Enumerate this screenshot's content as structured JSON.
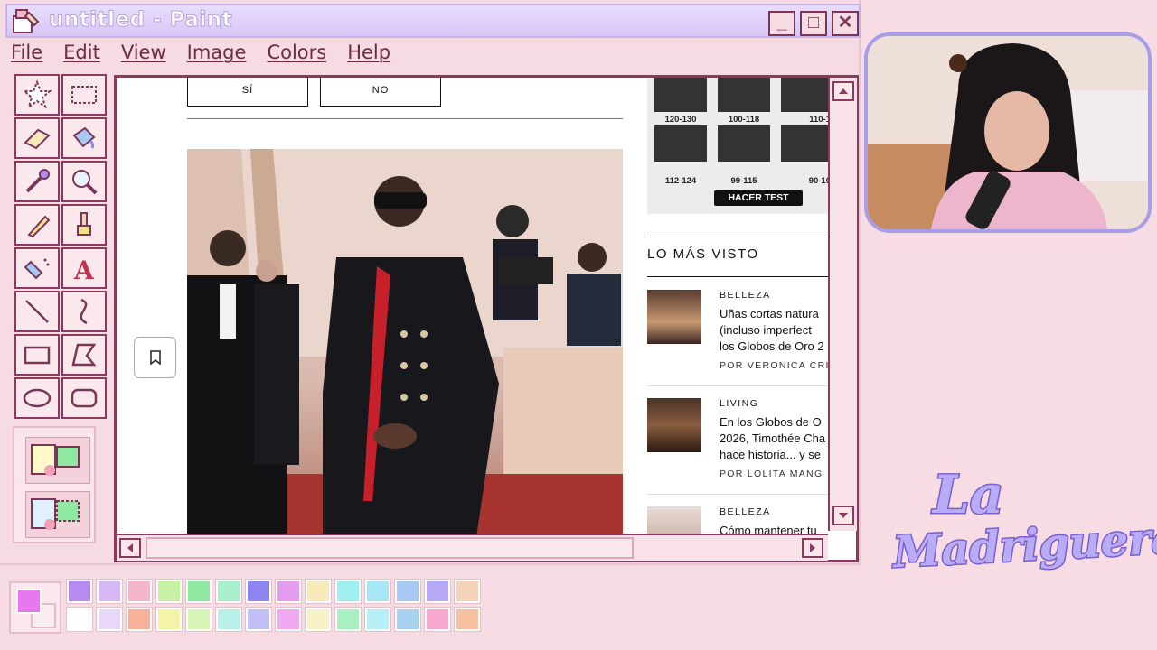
{
  "window": {
    "title": "untitled - Paint"
  },
  "menu": [
    "File",
    "Edit",
    "View",
    "Image",
    "Colors",
    "Help"
  ],
  "tools": [
    "free-select",
    "rect-select",
    "eraser",
    "fill",
    "color-picker",
    "magnifier",
    "pencil",
    "brush",
    "airbrush",
    "text",
    "line",
    "curve",
    "rectangle",
    "polygon",
    "ellipse",
    "rounded-rectangle"
  ],
  "web": {
    "buttons": {
      "yes": "SÍ",
      "no": "NO"
    },
    "iq": {
      "scores": [
        "120-130",
        "100-118",
        "110-1",
        "112-124",
        "99-115",
        "90-10"
      ],
      "button": "HACER TEST"
    },
    "lomas": {
      "heading": "LO MÁS VISTO"
    },
    "articles": [
      {
        "category": "BELLEZA",
        "title_lines": [
          "Uñas cortas natura",
          "(incluso imperfect",
          "los Globos de Oro 2"
        ],
        "author": "POR VERONICA CRIS"
      },
      {
        "category": "LIVING",
        "title_lines": [
          "En los Globos de O",
          "2026, Timothée Cha",
          "hace historia... y se"
        ],
        "author": "POR LOLITA MANG"
      },
      {
        "category": "BELLEZA",
        "title_lines": [
          "Cómo mantener tu"
        ],
        "author": ""
      }
    ]
  },
  "palette": {
    "foreground": "#e878f0",
    "background": "#f9edf0",
    "row1": [
      "#b68af0",
      "#d7b7f5",
      "#f4b6c8",
      "#c8f0a4",
      "#8fe8a0",
      "#a6f0cc",
      "#8e86f0",
      "#e49cf0",
      "#f7eab8",
      "#9ef0f0",
      "#a8e6f6",
      "#a8c8f5",
      "#b6a8f5",
      "#f6d2b8"
    ],
    "row2": [
      "#ffffff",
      "#e8d7f6",
      "#f7b09a",
      "#f4f4a8",
      "#d8f4b6",
      "#b6f0e8",
      "#c0c0f6",
      "#f0a8f0",
      "#f8f2c8",
      "#a8f0c0",
      "#b6f0f6",
      "#a8d0f0",
      "#f6a8d0",
      "#f6c0a0"
    ]
  },
  "logo": {
    "line1": "La",
    "line2": "Madriguera"
  }
}
